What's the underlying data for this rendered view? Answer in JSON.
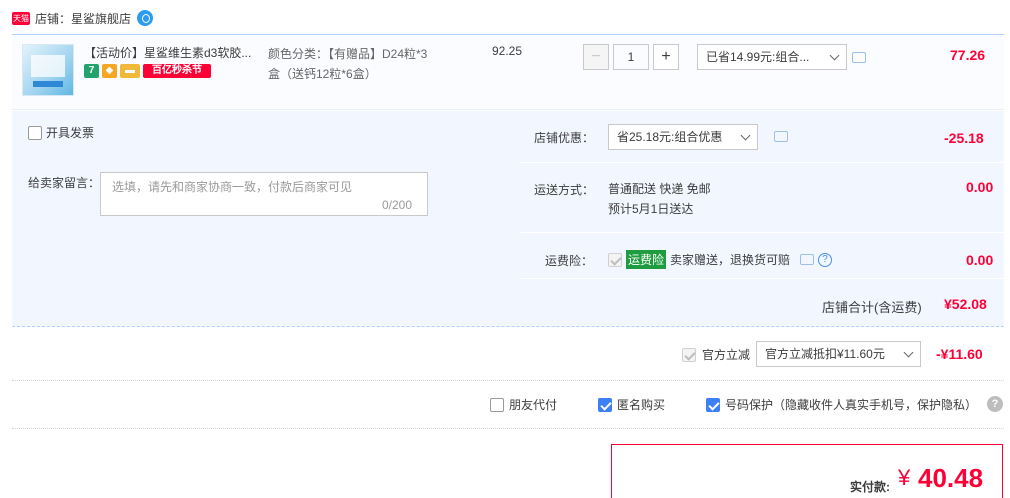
{
  "store": {
    "prefix": "店铺：",
    "name": "星鲨旗舰店",
    "badge": "天猫"
  },
  "item": {
    "title": "【活动价】星鲨维生素d3软胶...",
    "promo_tag": "百亿秒杀节",
    "variant_line1": "颜色分类：【有赠品】D24粒*3",
    "variant_line2": "盒（送钙12粒*6盒）",
    "unit_price": "92.25",
    "quantity": "1",
    "minus": "−",
    "plus": "+",
    "discount_select": "已省14.99元:组合...",
    "subtotal": "77.26"
  },
  "invoice": {
    "label": "开具发票"
  },
  "message": {
    "label": "给卖家留言：",
    "placeholder": "选填，请先和商家协商一致，付款后商家可见",
    "count": "0/200"
  },
  "store_discount": {
    "label": "店铺优惠：",
    "select": "省25.18元:组合优惠",
    "amount": "-25.18"
  },
  "shipping": {
    "label": "运送方式：",
    "method": "普通配送 快递 免邮",
    "eta": "预计5月1日送达",
    "amount": "0.00"
  },
  "insurance": {
    "label": "运费险：",
    "tag": "运费险",
    "desc": "卖家赠送，退换货可赔",
    "amount": "0.00"
  },
  "store_total": {
    "label": "店铺合计(含运费)",
    "amount": "¥52.08"
  },
  "official": {
    "label": "官方立减",
    "select": "官方立减抵扣¥11.60元",
    "amount": "-¥11.60"
  },
  "options": {
    "friend_pay": "朋友代付",
    "anonymous": "匿名购买",
    "number_protect": "号码保护（隐藏收件人真实手机号，保护隐私）",
    "help": "?"
  },
  "payment": {
    "label": "实付款:",
    "currency": "¥",
    "amount": "40.48"
  },
  "colors": {
    "accent_red": "#ff0036",
    "accent_blue": "#3d7ff5",
    "panel_bg": "#f2f7ff"
  }
}
